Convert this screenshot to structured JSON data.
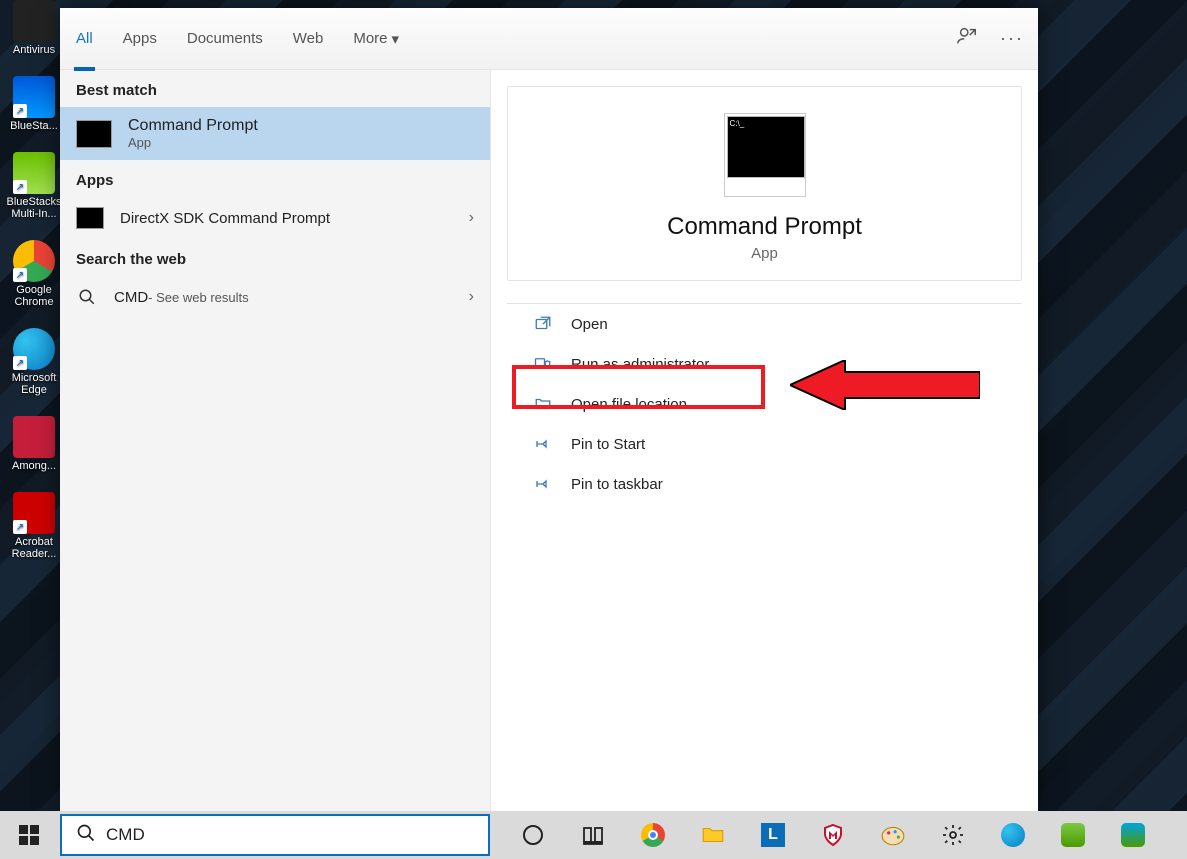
{
  "desktop_icons": [
    {
      "label": "Antivirus",
      "color": "#222"
    },
    {
      "label": "BlueSta...",
      "color": "#0a84ff"
    },
    {
      "label": "BlueStacks Multi-In...",
      "color": "#7ac943"
    },
    {
      "label": "Google Chrome",
      "color": "#fbbc05"
    },
    {
      "label": "Microsoft Edge",
      "color": "#0a84d6"
    },
    {
      "label": "Among...",
      "color": "#c41e3a"
    },
    {
      "label": "Acrobat Reader...",
      "color": "#c00"
    }
  ],
  "search": {
    "tabs": [
      "All",
      "Apps",
      "Documents",
      "Web",
      "More"
    ],
    "active_tab": "All",
    "left": {
      "best_match_header": "Best match",
      "best_match": {
        "title": "Command Prompt",
        "subtitle": "App"
      },
      "apps_header": "Apps",
      "apps": [
        {
          "title": "DirectX SDK Command Prompt"
        }
      ],
      "web_header": "Search the web",
      "web": [
        {
          "title": "CMD",
          "subtitle": " - See web results"
        }
      ]
    },
    "right": {
      "title": "Command Prompt",
      "subtitle": "App",
      "actions": [
        "Open",
        "Run as administrator",
        "Open file location",
        "Pin to Start",
        "Pin to taskbar"
      ]
    }
  },
  "taskbar": {
    "search_value": "CMD",
    "icons": [
      "cortana",
      "task-view",
      "chrome",
      "file-explorer",
      "app-l",
      "mcafee",
      "paint",
      "settings",
      "edge",
      "bluestacks",
      "bluestacks-x"
    ]
  }
}
